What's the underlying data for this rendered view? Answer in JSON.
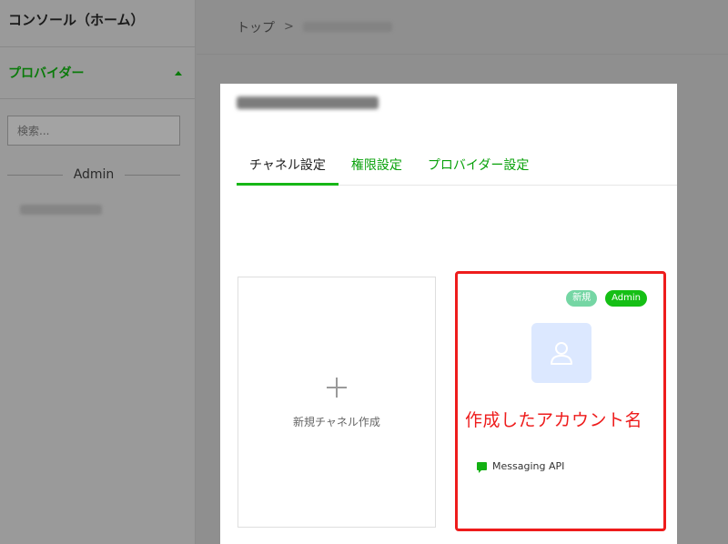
{
  "sidebar": {
    "title": "コンソール（ホーム）",
    "provider_label": "プロバイダー",
    "search_placeholder": "検索...",
    "section_label": "Admin"
  },
  "breadcrumb": {
    "home": "トップ",
    "separator": ">"
  },
  "modal": {
    "tabs": [
      {
        "label": "チャネル設定",
        "active": true
      },
      {
        "label": "権限設定",
        "active": false
      },
      {
        "label": "プロバイダー設定",
        "active": false
      }
    ],
    "new_channel_label": "新規チャネル作成",
    "channel_card": {
      "badges": {
        "new": "新規",
        "admin": "Admin"
      },
      "annotation": "作成したアカウント名",
      "platform_label": "Messaging API",
      "avatar_icon": "user-icon"
    }
  },
  "colors": {
    "accent_green": "#08a10a",
    "highlight_red": "#ee1c1c",
    "avatar_bg": "#dce8ff"
  }
}
